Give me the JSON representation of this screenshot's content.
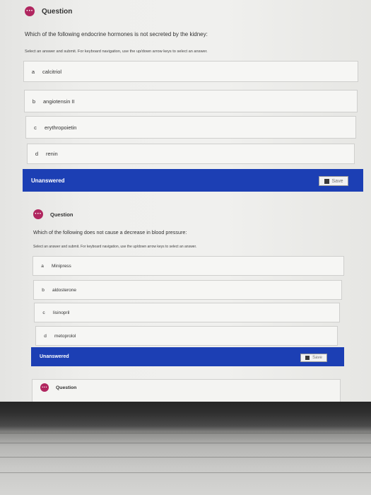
{
  "questions": [
    {
      "title": "Question",
      "prompt": "Which of the following endocrine hormones is not secreted by the kidney:",
      "instruction": "Select an answer and submit. For keyboard navigation, use the up/down arrow keys to select an answer.",
      "options": [
        {
          "letter": "a",
          "text": "calcitriol"
        },
        {
          "letter": "b",
          "text": "angiotensin II"
        },
        {
          "letter": "c",
          "text": "erythropoietin"
        },
        {
          "letter": "d",
          "text": "renin"
        }
      ],
      "status": "Unanswered",
      "save_label": "Save"
    },
    {
      "title": "Question",
      "prompt": "Which of the following does not cause a decrease in blood pressure:",
      "instruction": "Select an answer and submit. For keyboard navigation, use the up/down arrow keys to select an answer.",
      "options": [
        {
          "letter": "a",
          "text": "Minipress"
        },
        {
          "letter": "b",
          "text": "aldosterone"
        },
        {
          "letter": "c",
          "text": "lisinopril"
        },
        {
          "letter": "d",
          "text": "metoprolol"
        }
      ],
      "status": "Unanswered",
      "save_label": "Save"
    },
    {
      "title": "Question"
    }
  ],
  "icons": {
    "question": "ellipsis-icon",
    "save": "save-icon"
  },
  "colors": {
    "accent_bar": "#1c3fb4",
    "question_icon": "#b0265f"
  }
}
